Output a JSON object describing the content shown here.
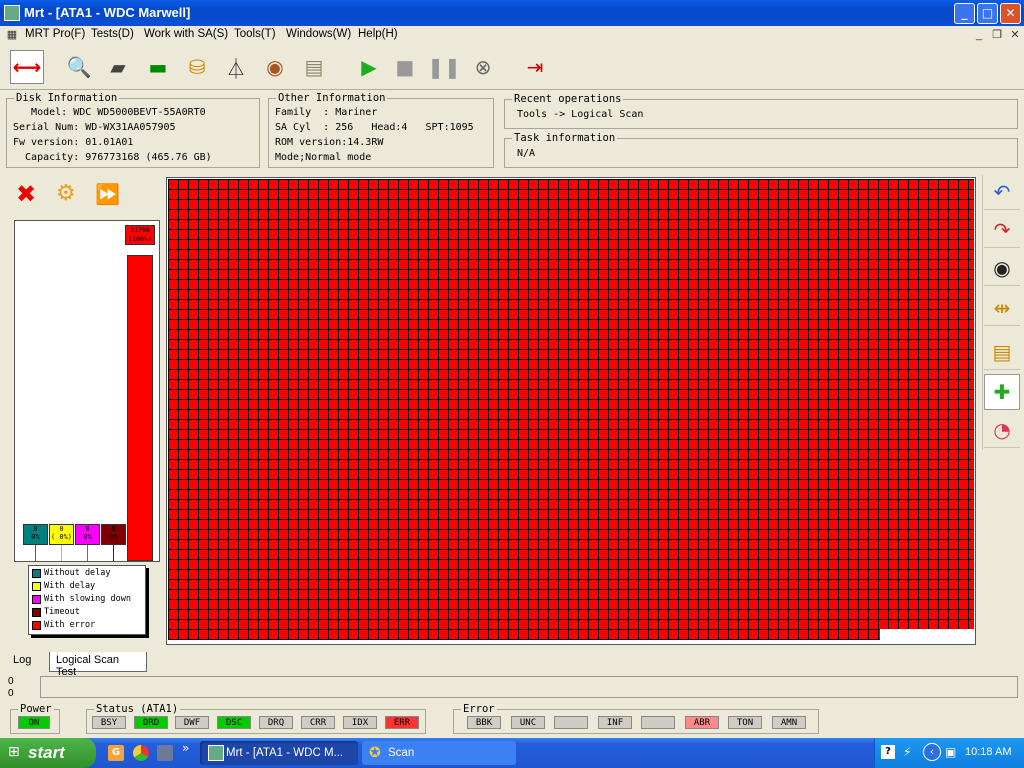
{
  "window": {
    "title": "Mrt - [ATA1 - WDC Marwell]",
    "minimize": "_",
    "maximize": "□",
    "close": "✕"
  },
  "menu": [
    "MRT Pro(F)",
    "Tests(D)",
    "Work with SA(S)",
    "Tools(T)",
    "Windows(W)",
    "Help(H)"
  ],
  "disk_info": {
    "legend": "Disk Information",
    "lines": [
      "   Model: WDC WD5000BEVT-55A0RT0",
      "Serial Num: WD-WX31AA057905",
      "Fw version: 01.01A01",
      "  Capacity: 976773168 (465.76 GB)"
    ]
  },
  "other_info": {
    "legend": "Other Information",
    "lines": [
      "Family  : Mariner",
      "SA Cyl  : 256   Head:4   SPT:1095",
      "ROM version:14.3RW",
      "Mode;Normal mode"
    ]
  },
  "recent_ops": {
    "legend": "Recent operations",
    "value": "Tools -> Logical Scan"
  },
  "task_info": {
    "legend": "Task information",
    "value": "N/A"
  },
  "scan_bars": {
    "without_delay": {
      "count": "0",
      "pct": "0%",
      "color": "#008080"
    },
    "with_delay": {
      "count": "0",
      "pct": "( 0%)",
      "color": "#ffff00"
    },
    "slowing_down": {
      "count": "0",
      "pct": "0%",
      "color": "#ff00ff"
    },
    "timeout": {
      "count": "0",
      "pct": "0%",
      "color": "#800000"
    },
    "with_error": {
      "count": "31798",
      "pct": "(100%)",
      "color": "#ff0000"
    }
  },
  "legend": [
    "Without delay",
    "With delay",
    "With slowing down",
    "Timeout",
    "With error"
  ],
  "tabs": [
    "Log",
    "Logical Scan Test"
  ],
  "counters": [
    "0",
    "0"
  ],
  "power": {
    "label": "Power",
    "on": "ON"
  },
  "status": {
    "label": "Status (ATA1)",
    "flags": [
      "BSY",
      "DRD",
      "DWF",
      "DSC",
      "DRQ",
      "CRR",
      "IDX",
      "ERR"
    ]
  },
  "error": {
    "label": "Error",
    "flags": [
      "BBK",
      "UNC",
      "",
      "INF",
      "",
      "ABR",
      "TON",
      "AMN"
    ]
  },
  "taskbar": {
    "start": "start",
    "apps": [
      "Mrt - [ATA1 - WDC M...",
      "Scan"
    ],
    "time": "10:18 AM",
    "overflow": "»"
  },
  "colors": {
    "title_blue": "#0a5ce6",
    "scan_error": "#ff0000",
    "status_active": "#00cc00",
    "error_active": "#ff6666"
  }
}
